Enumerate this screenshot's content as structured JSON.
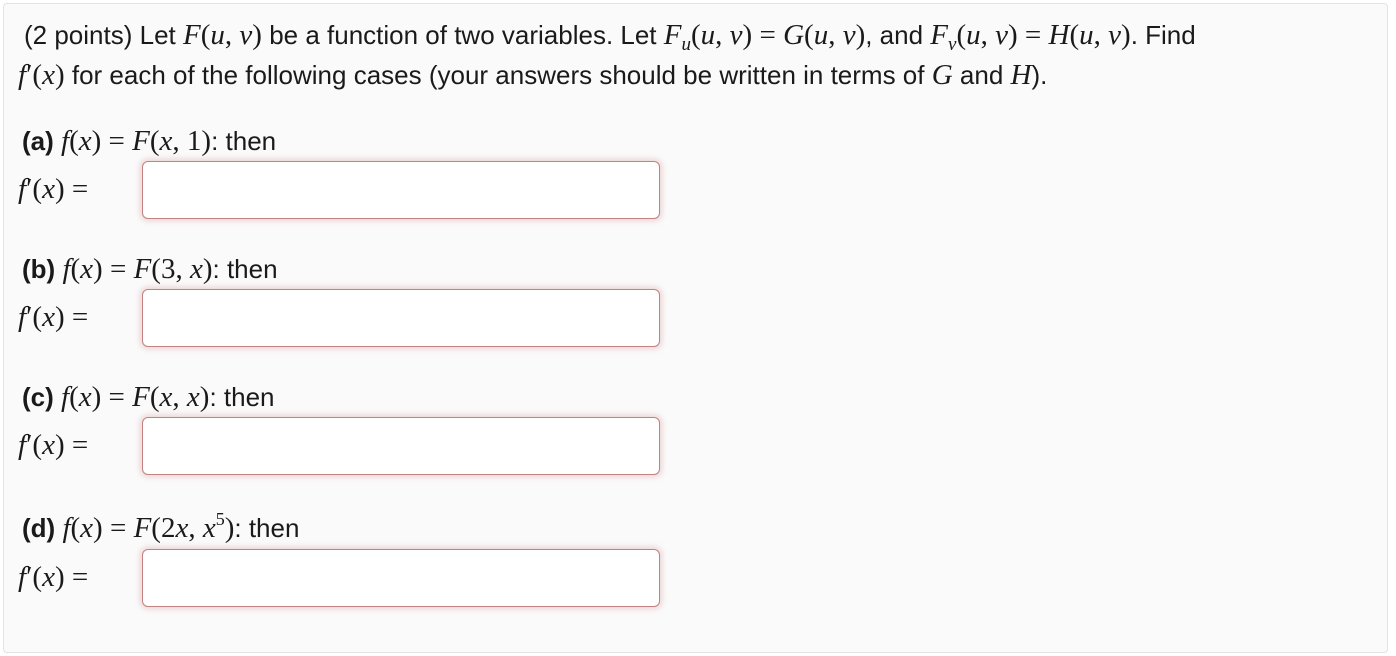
{
  "intro": {
    "points": "(2 points)",
    "t1": "Let",
    "t2": "be a function of two variables. Let",
    "t3": ", and",
    "t4": ". Find",
    "t5": "for each of the following cases (your answers should be written in terms of",
    "t6": "and",
    "t7": ")."
  },
  "parts": [
    {
      "label": "(a)",
      "then": ": then",
      "fprime": "f'(x) =",
      "value": "",
      "placeholder": ""
    },
    {
      "label": "(b)",
      "then": ": then",
      "fprime": "f'(x) =",
      "value": "",
      "placeholder": ""
    },
    {
      "label": "(c)",
      "then": ": then",
      "fprime": "f'(x) =",
      "value": "",
      "placeholder": ""
    },
    {
      "label": "(d)",
      "then": ": then",
      "fprime": "f'(x) =",
      "value": "",
      "placeholder": ""
    }
  ],
  "colors": {
    "answer_border": "#c38282",
    "background": "#fafafa"
  }
}
